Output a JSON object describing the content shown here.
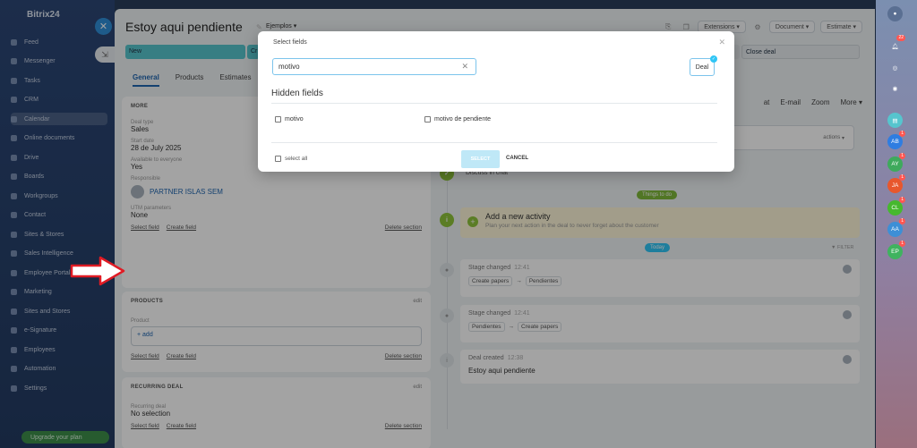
{
  "leftnav": {
    "logo": "Bitrix24",
    "items": [
      "Feed",
      "Messenger",
      "Tasks",
      "CRM",
      "Calendar",
      "Online documents",
      "Drive",
      "Boards",
      "Workgroups",
      "Contact",
      "Sites & Stores",
      "Sales Intelligence",
      "Employee Portal",
      "Marketing",
      "Sites and Stores",
      "e-Signature",
      "Employees",
      "Automation",
      "Settings"
    ],
    "active_index": 4,
    "bottom_label": "Upgrade your plan"
  },
  "panel": {
    "title": "Estoy aqui pendiente",
    "category": "Ejemplos",
    "toolbar": {
      "extensions": "Extensions",
      "document": "Document",
      "estimate": "Estimate"
    },
    "stages": {
      "first": "New",
      "second": "Cr",
      "close": "Close deal"
    },
    "tabs": [
      "General",
      "Products",
      "Estimates"
    ],
    "more": {
      "header": "MORE",
      "deal_type_label": "Deal type",
      "deal_type": "Sales",
      "start_date_label": "Start date",
      "start_date": "28 de July 2025",
      "available_label": "Available to everyone",
      "available": "Yes",
      "responsible_label": "Responsible",
      "responsible": "PARTNER ISLAS SEM",
      "utm_label": "UTM parameters",
      "utm": "None",
      "select_field": "Select field",
      "create_field": "Create field",
      "delete_section": "Delete section"
    },
    "products": {
      "header": "PRODUCTS",
      "edit": "edit",
      "product_label": "Product",
      "add": "+ add",
      "select_field": "Select field",
      "create_field": "Create field",
      "delete_section": "Delete section"
    },
    "recurring": {
      "header": "RECURRING DEAL",
      "edit": "edit",
      "label": "Recurring deal",
      "value": "No selection",
      "select_field": "Select field",
      "create_field": "Create field",
      "delete_section": "Delete section"
    },
    "right": {
      "comm_tabs": [
        "at",
        "E-mail",
        "Zoom",
        "More"
      ],
      "actions": "actions",
      "discuss": "Discuss in chat",
      "things_to_do": "Things to do",
      "activity_title": "Add a new activity",
      "activity_sub": "Plan your next action in the deal to never forget about the customer",
      "today": "Today",
      "filter": "FILTER",
      "events": [
        {
          "title": "Stage changed",
          "time": "12:41",
          "from": "Create papers",
          "to": "Pendientes"
        },
        {
          "title": "Stage changed",
          "time": "12:41",
          "from": "Pendientes",
          "to": "Create papers"
        },
        {
          "title": "Deal created",
          "time": "12:38",
          "body": "Estoy aqui pendiente"
        }
      ]
    }
  },
  "modal": {
    "title": "Select fields",
    "search_value": "motivo",
    "entity": "Deal",
    "hidden_title": "Hidden fields",
    "options": [
      "motivo",
      "motivo de pendiente"
    ],
    "select_all": "select all",
    "select_btn": "SELECT",
    "cancel_btn": "CANCEL"
  },
  "rightrail": {
    "avatars": [
      {
        "initials": "AB",
        "color": "#2f7de1",
        "badge": "1"
      },
      {
        "initials": "AY",
        "color": "#3eaa5c",
        "badge": "1"
      },
      {
        "initials": "JA",
        "color": "#e8572d",
        "badge": "1"
      },
      {
        "initials": "CL",
        "color": "#46b82e",
        "badge": "1"
      },
      {
        "initials": "AA",
        "color": "#3d8fd6",
        "badge": "1"
      },
      {
        "initials": "EP",
        "color": "#3fb35f",
        "badge": "1"
      }
    ],
    "notif_badge": "22"
  },
  "colors": {
    "accent": "#2066b0",
    "stage": "#56c5ce",
    "arrow": "#e01b24"
  }
}
